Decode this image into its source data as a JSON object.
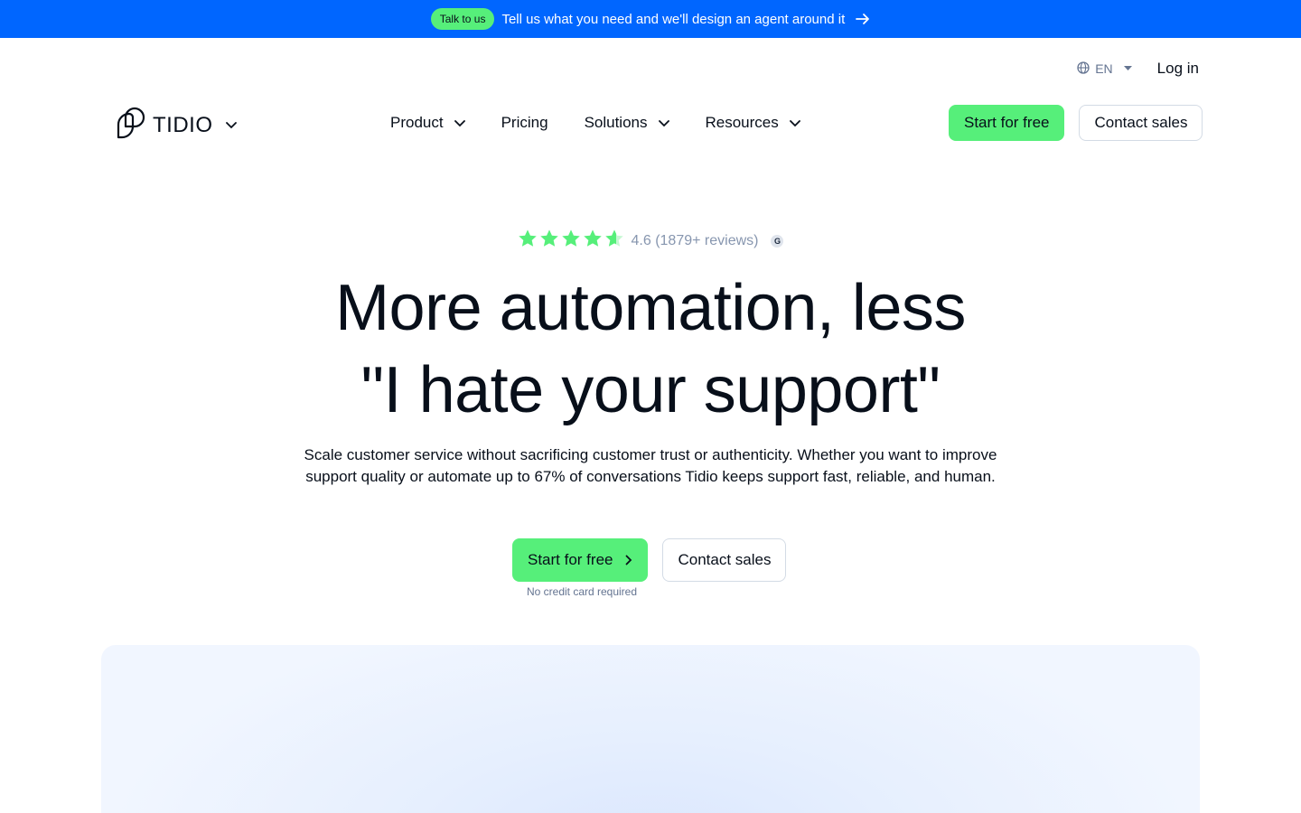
{
  "banner": {
    "badge": "Talk to us",
    "text": "Tell us what you need and we'll design an agent around it",
    "arrow_icon": "arrow-right-icon"
  },
  "utility": {
    "language": "EN",
    "login": "Log in"
  },
  "logo": {
    "text": "TIDIO"
  },
  "nav": {
    "items": [
      {
        "label": "Product",
        "has_dropdown": true
      },
      {
        "label": "Pricing",
        "has_dropdown": false
      },
      {
        "label": "Solutions",
        "has_dropdown": true
      },
      {
        "label": "Resources",
        "has_dropdown": true
      }
    ],
    "start_free": "Start for free",
    "contact_sales": "Contact sales"
  },
  "hero": {
    "rating": "4.6 (1879+ reviews)",
    "rating_stars": 4.6,
    "headline_line1": "More automation, less",
    "headline_line2": "\"I hate your support\"",
    "subtext_line1": "Scale customer service without sacrificing customer trust or authenticity. Whether you want to improve",
    "subtext_line2": "support quality or automate up to 67% of conversations Tidio keeps support fast, reliable, and human.",
    "cta_primary": "Start for free",
    "cta_secondary": "Contact sales",
    "note": "No credit card required"
  },
  "colors": {
    "banner_bg": "#0066ff",
    "accent_green": "#56ef7a",
    "text_dark": "#080f1a",
    "muted": "#647491"
  }
}
